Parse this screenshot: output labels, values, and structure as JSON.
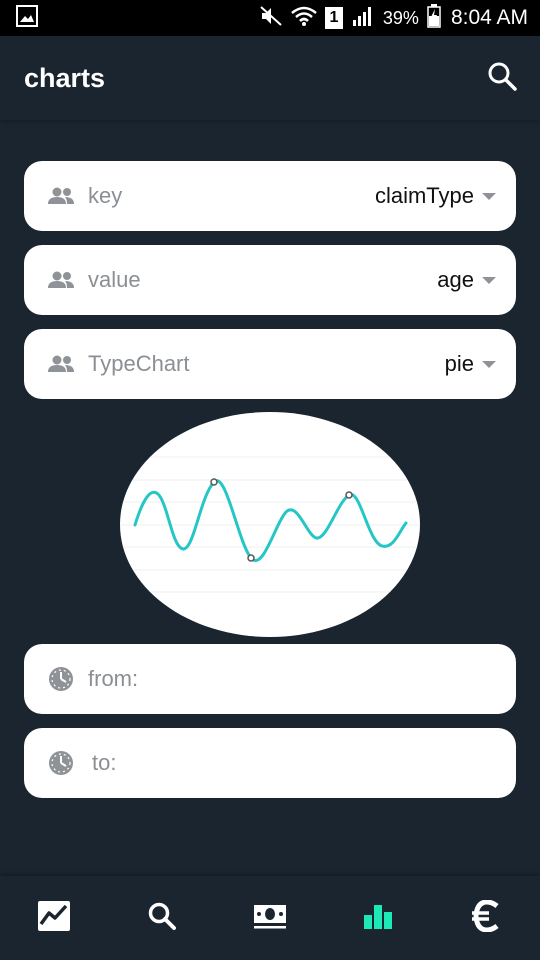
{
  "status_bar": {
    "battery": "39%",
    "time": "8:04 AM",
    "sim_slot": "1"
  },
  "app_bar": {
    "title": "charts",
    "icons": [
      "search-icon"
    ]
  },
  "form": {
    "key": {
      "label": "key",
      "value": "claimType",
      "icon": "people-icon"
    },
    "value": {
      "label": "value",
      "value": "age",
      "icon": "people-icon"
    },
    "type_chart": {
      "label": "TypeChart",
      "value": "pie",
      "icon": "people-icon"
    },
    "from": {
      "label": "from:",
      "value": "",
      "icon": "clock-icon"
    },
    "to": {
      "label": "to:",
      "value": "",
      "icon": "clock-icon"
    }
  },
  "colors": {
    "background": "#1b2530",
    "accent": "#1de9b6",
    "line": "#26c6c6"
  },
  "bottom_nav": {
    "items": [
      "chart-line-icon",
      "search-icon",
      "money-icon",
      "bar-chart-icon",
      "euro-icon"
    ],
    "active": "bar-chart-icon"
  }
}
